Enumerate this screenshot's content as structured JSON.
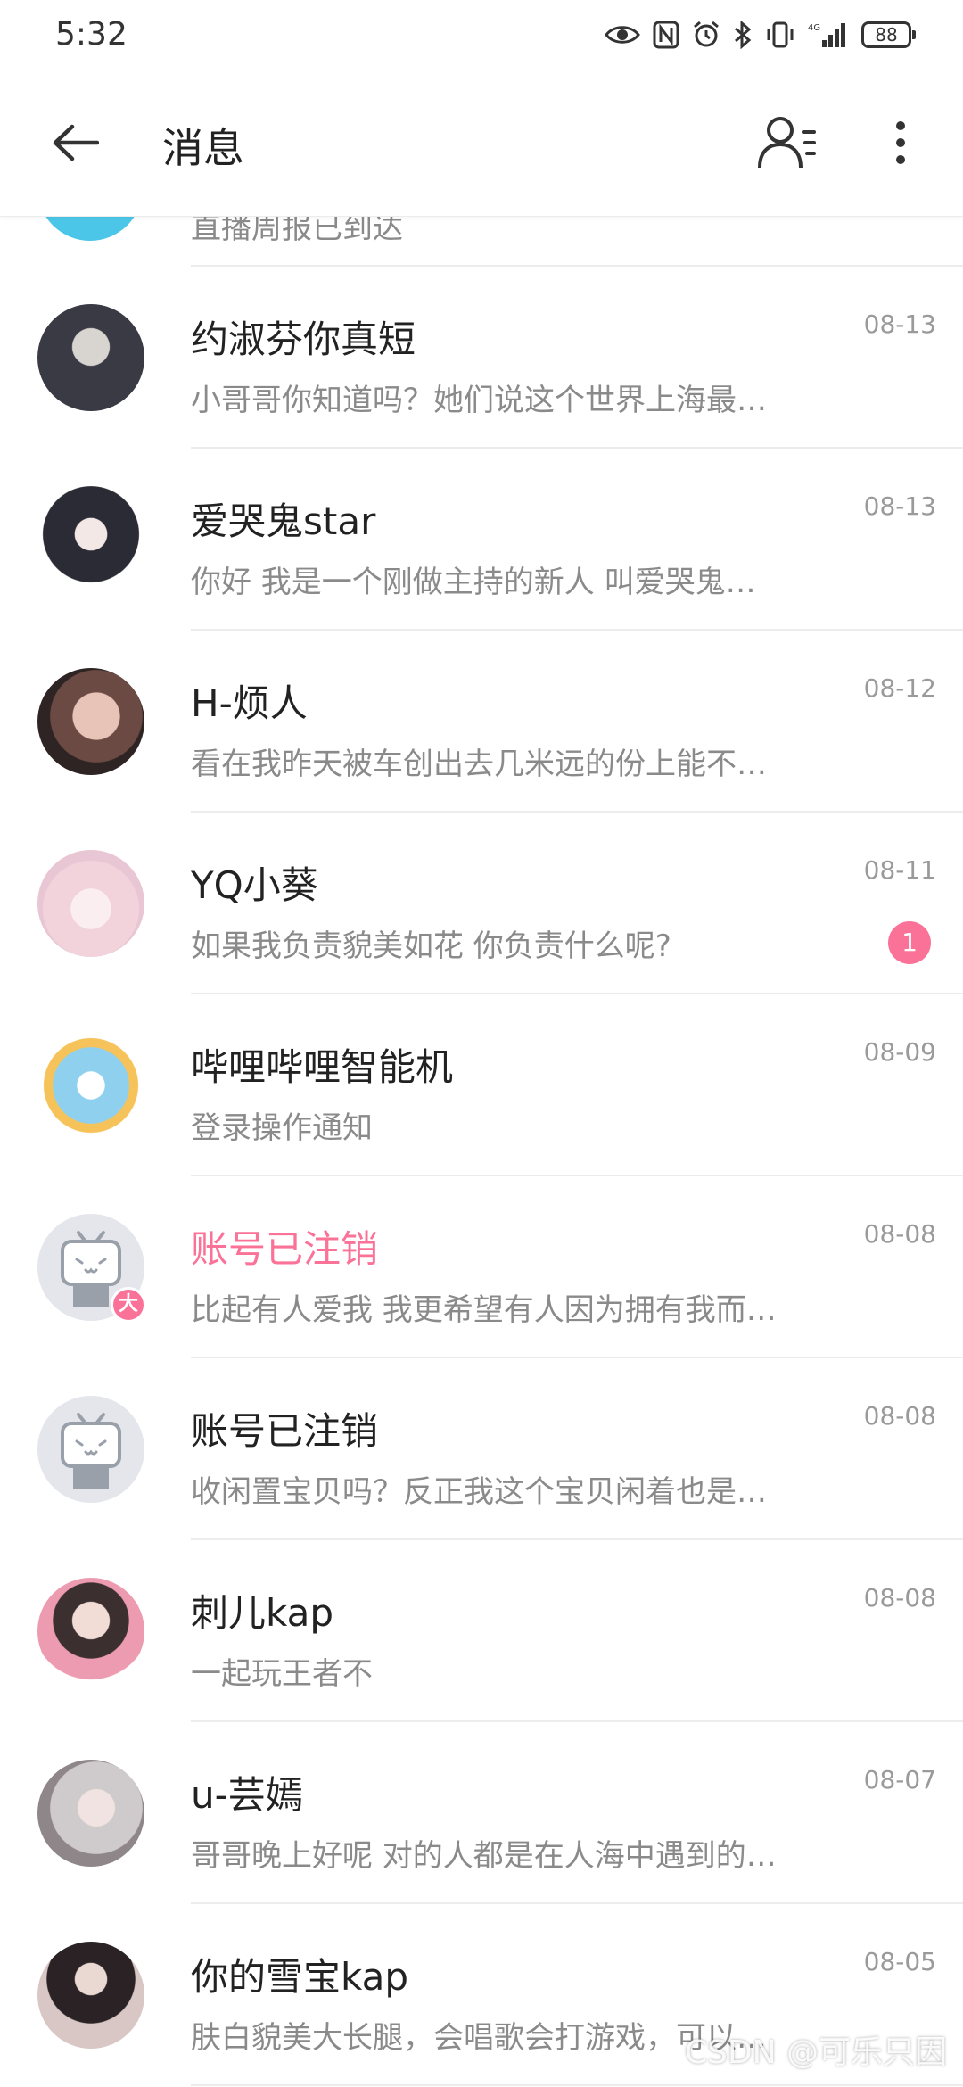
{
  "status_bar": {
    "time": "5:32",
    "battery": "88"
  },
  "header": {
    "title": "消息"
  },
  "partial_row": {
    "preview": "直播周报已到达"
  },
  "rows": [
    {
      "name": "约淑芬你真短",
      "preview": "小哥哥你知道吗？她们说这个世界上海最…",
      "date": "08-13",
      "avatar_color": "#3a3a44"
    },
    {
      "name": "爱哭鬼star",
      "preview": "你好 我是一个刚做主持的新人 叫爱哭鬼…",
      "date": "08-13",
      "avatar_color": "#2b2b35"
    },
    {
      "name": "H-烦人",
      "preview": "看在我昨天被车创出去几米远的份上能不…",
      "date": "08-12",
      "avatar_color": "#c08a82"
    },
    {
      "name": "YQ小葵",
      "preview": "如果我负责貌美如花 你负责什么呢?",
      "date": "08-11",
      "avatar_color": "#f2d3dc",
      "unread": "1"
    },
    {
      "name": "哔哩哔哩智能机",
      "preview": "登录操作通知",
      "date": "08-09",
      "avatar_color": "#8fd0ef"
    },
    {
      "name": "账号已注销",
      "preview": "比起有人爱我 我更希望有人因为拥有我而…",
      "date": "08-08",
      "avatar_color": "#e4e6ec",
      "highlight": true,
      "badge": "大"
    },
    {
      "name": "账号已注销",
      "preview": "收闲置宝贝吗？反正我这个宝贝闲着也是…",
      "date": "08-08",
      "avatar_color": "#e4e6ec"
    },
    {
      "name": "刺儿kap",
      "preview": "一起玩王者不",
      "date": "08-08",
      "avatar_color": "#d7a9ad"
    },
    {
      "name": "u-芸嫣",
      "preview": "哥哥晚上好呢 对的人都是在人海中遇到的…",
      "date": "08-07",
      "avatar_color": "#b8b3b5"
    },
    {
      "name": "你的雪宝kap",
      "preview": "肤白貌美大长腿，会唱歌会打游戏，可以…",
      "date": "08-05",
      "avatar_color": "#4a3c3e"
    }
  ],
  "watermark": "CSDN @可乐只因",
  "colors": {
    "accent_pink": "#fb7299",
    "default_avatar_bg": "#e4e6ec"
  }
}
